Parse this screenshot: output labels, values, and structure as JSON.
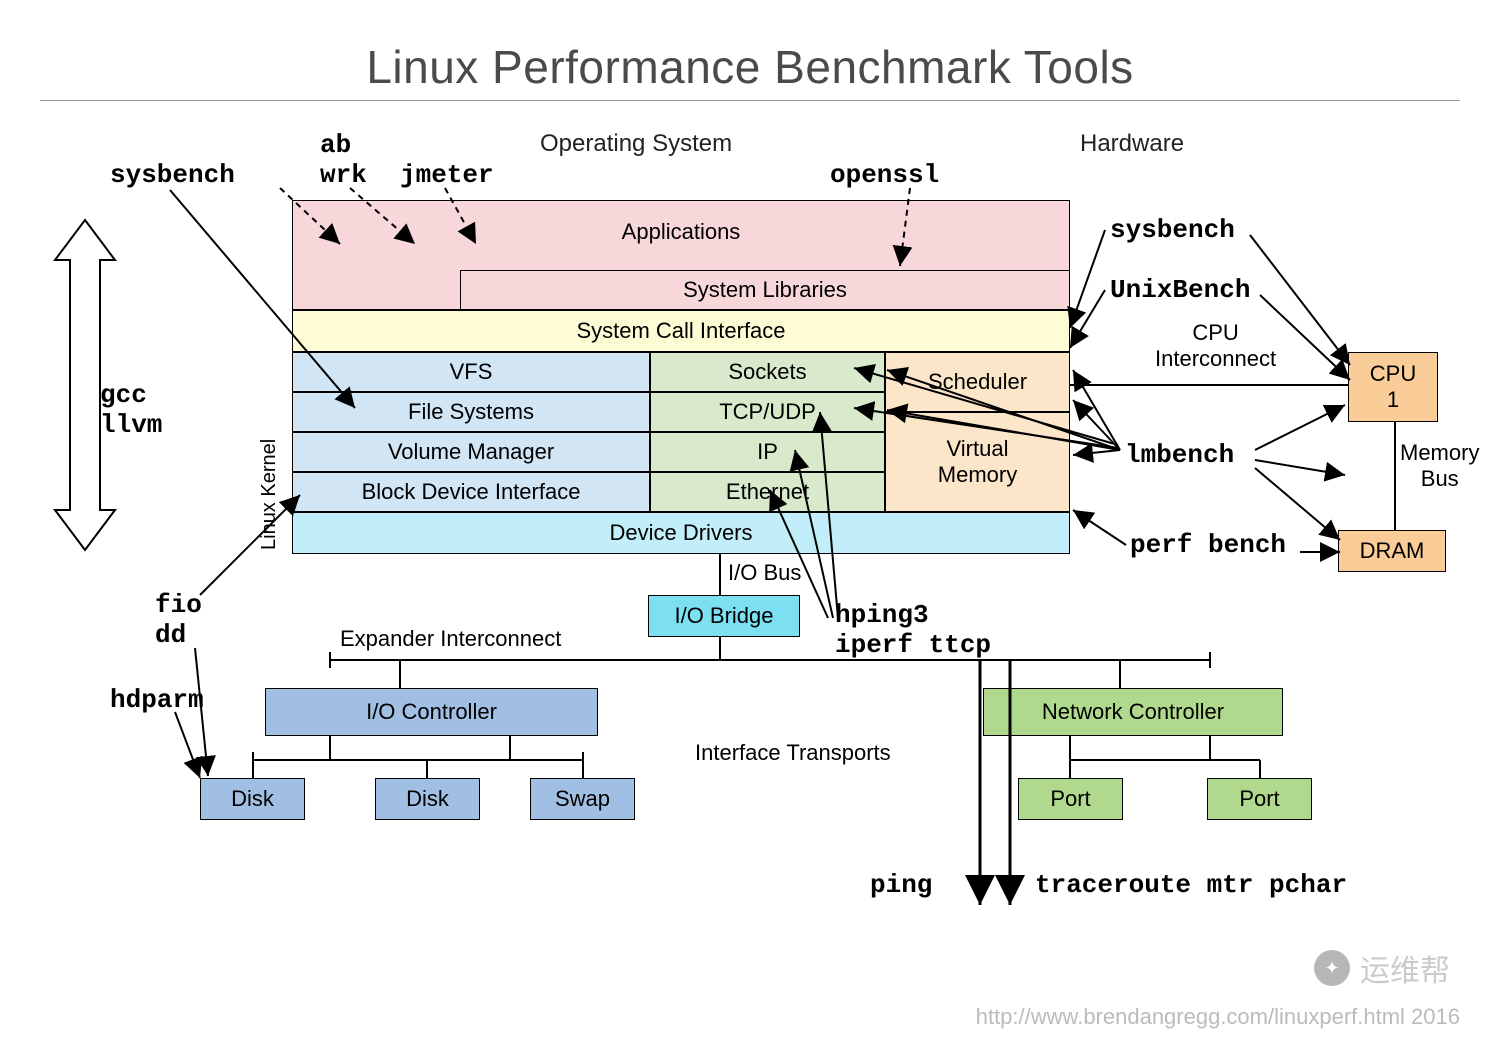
{
  "title": "Linux Performance Benchmark Tools",
  "sections": {
    "os": "Operating System",
    "hw": "Hardware"
  },
  "tools": {
    "sysbench": "sysbench",
    "ab": "ab",
    "wrk": "wrk",
    "jmeter": "jmeter",
    "openssl": "openssl",
    "sysbench2": "sysbench",
    "unixbench": "UnixBench",
    "gcc": "gcc",
    "llvm": "llvm",
    "lmbench": "lmbench",
    "perf_bench": "perf bench",
    "fio": "fio",
    "dd": "dd",
    "hdparm": "hdparm",
    "hping3": "hping3",
    "iperf_ttcp": "iperf ttcp",
    "ping": "ping",
    "traceroute_mtr_pchar": "traceroute mtr pchar"
  },
  "blocks": {
    "applications": "Applications",
    "system_libraries": "System Libraries",
    "system_call_interface": "System Call Interface",
    "vfs": "VFS",
    "file_systems": "File Systems",
    "volume_manager": "Volume Manager",
    "block_device_interface": "Block Device Interface",
    "sockets": "Sockets",
    "tcp_udp": "TCP/UDP",
    "ip": "IP",
    "ethernet": "Ethernet",
    "scheduler": "Scheduler",
    "virtual_memory": "Virtual\nMemory",
    "device_drivers": "Device Drivers",
    "io_bridge": "I/O Bridge",
    "io_controller": "I/O Controller",
    "network_controller": "Network Controller",
    "disk1": "Disk",
    "disk2": "Disk",
    "swap": "Swap",
    "port1": "Port",
    "port2": "Port",
    "cpu1": "CPU\n1",
    "dram": "DRAM"
  },
  "labels": {
    "linux_kernel": "Linux Kernel",
    "cpu_interconnect": "CPU\nInterconnect",
    "memory_bus": "Memory\nBus",
    "io_bus": "I/O Bus",
    "expander_interconnect": "Expander Interconnect",
    "interface_transports": "Interface Transports"
  },
  "footer": "http://www.brendangregg.com/linuxperf.html 2016",
  "watermark": "运维帮"
}
